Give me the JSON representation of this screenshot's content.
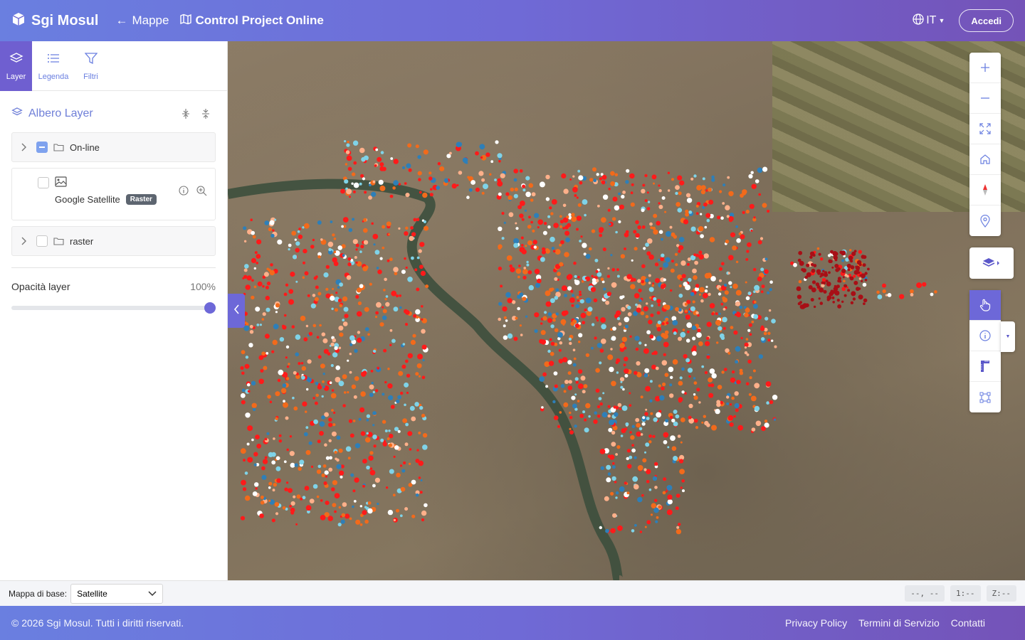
{
  "header": {
    "brand": "Sgi Mosul",
    "back_label": "Mappe",
    "project_title": "Control Project Online",
    "language": "IT",
    "login_label": "Accedi"
  },
  "sidebar": {
    "tabs": [
      {
        "label": "Layer",
        "icon": "layers-icon",
        "active": true
      },
      {
        "label": "Legenda",
        "icon": "list-icon"
      },
      {
        "label": "Filtri",
        "icon": "filter-icon"
      }
    ],
    "tree_title": "Albero Layer",
    "layers": [
      {
        "name": "On-line",
        "checked": "partial"
      },
      {
        "name": "Google Satellite",
        "badge": "Raster",
        "checked": false
      },
      {
        "name": "raster",
        "checked": false
      }
    ],
    "opacity_label": "Opacità layer",
    "opacity_value": "100%",
    "opacity_fraction": 1.0
  },
  "bottom_bar": {
    "base_map_label": "Mappa di base:",
    "base_map_value": "Satellite",
    "coords": "--, --",
    "scale": "1:--",
    "zoom": "Z:--"
  },
  "footer": {
    "copyright": "© 2026 Sgi Mosul. Tutti i diritti riservati.",
    "links": [
      "Privacy Policy",
      "Termini di Servizio",
      "Contatti"
    ]
  },
  "colors": {
    "accent": "#6d68d8",
    "header_start": "#6a7fe0",
    "header_end": "#7453b8",
    "point_red": "#ff1a1a",
    "point_orange": "#f26a1b",
    "point_darkred": "#a80f16"
  }
}
